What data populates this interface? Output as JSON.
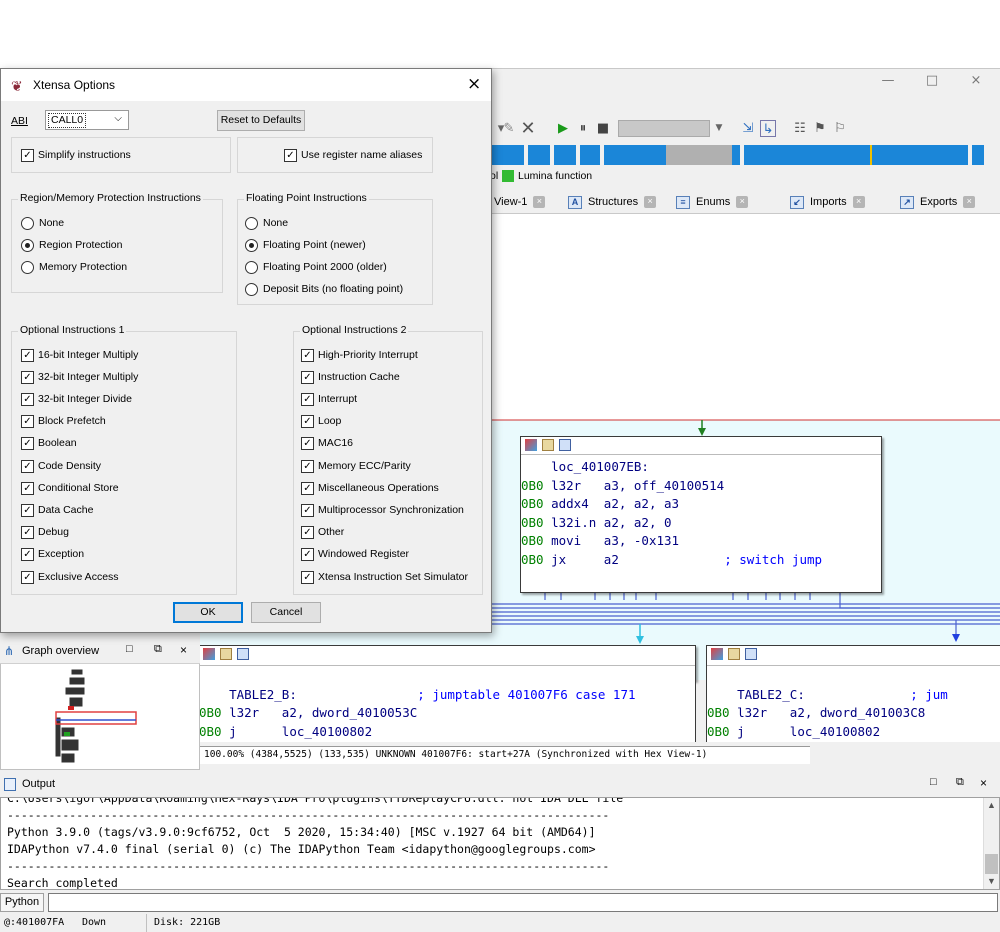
{
  "main_window": {
    "controls": {
      "minimize": "—",
      "maximize": "□",
      "close": "×"
    },
    "legend": {
      "partial_label": "ol",
      "lumina_label": "Lumina function",
      "lumina_color": "#33bb33"
    },
    "tabs": [
      {
        "label": "View-1",
        "icon": "hex-view-icon"
      },
      {
        "label": "Structures",
        "icon": "structures-icon"
      },
      {
        "label": "Enums",
        "icon": "enums-icon"
      },
      {
        "label": "Imports",
        "icon": "imports-icon"
      },
      {
        "label": "Exports",
        "icon": "exports-icon"
      }
    ],
    "graph": {
      "main_node": {
        "label": "loc_401007EB:",
        "lines": [
          {
            "addr": "0B0",
            "mnem": "l32r   ",
            "ops": "a3, off_40100514",
            "cmt": ""
          },
          {
            "addr": "0B0",
            "mnem": "addx4  ",
            "ops": "a2, a2, a3",
            "cmt": ""
          },
          {
            "addr": "0B0",
            "mnem": "l32i.n ",
            "ops": "a2, a2, 0",
            "cmt": ""
          },
          {
            "addr": "0B0",
            "mnem": "movi   ",
            "ops": "a3, -0x131",
            "cmt": ""
          },
          {
            "addr": "0B0",
            "mnem": "jx     ",
            "ops": "a2",
            "cmt": "; switch jump"
          }
        ]
      },
      "node_b": {
        "label": "TABLE2_B:",
        "label_cmt": "; jumptable 401007F6 case 171",
        "lines": [
          {
            "addr": "0B0",
            "mnem": "l32r   ",
            "ops": "a2, dword_4010053C"
          },
          {
            "addr": "0B0",
            "mnem": "j      ",
            "ops": "loc_40100802"
          }
        ]
      },
      "node_c": {
        "label": "TABLE2_C:",
        "label_cmt": "; jum",
        "lines": [
          {
            "addr": "0B0",
            "mnem": "l32r   ",
            "ops": "a2, dword_401003C8"
          },
          {
            "addr": "0B0",
            "mnem": "j      ",
            "ops": "loc_40100802"
          }
        ]
      }
    },
    "graph_status": "100.00% (4384,5525) (133,535) UNKNOWN 401007F6: start+27A (Synchronized with Hex View-1)",
    "overview": {
      "title": "Graph overview"
    },
    "output": {
      "title": "Output",
      "lines": [
        "C:\\Users\\igor\\AppData\\Roaming\\Hex-Rays\\IDA Pro\\plugins\\TTDReplayCPU.dll: not IDA DLL file",
        "---------------------------------------------------------------------------------------",
        "Python 3.9.0 (tags/v3.9.0:9cf6752, Oct  5 2020, 15:34:40) [MSC v.1927 64 bit (AMD64)]",
        "IDAPython v7.4.0 final (serial 0) (c) The IDAPython Team <idapython@googlegroups.com>",
        "---------------------------------------------------------------------------------------",
        "Search completed"
      ],
      "python_button": "Python"
    },
    "status_bar": {
      "address": "@:401007FA",
      "direction": "Down",
      "disk": "Disk: 221GB"
    }
  },
  "dialog": {
    "title": "Xtensa Options",
    "abi_label": "ABI",
    "abi_value": "CALL0",
    "reset_button": "Reset to Defaults",
    "simplify": "Simplify instructions",
    "register_aliases": "Use register name aliases",
    "region_group": {
      "title": "Region/Memory Protection Instructions",
      "options": [
        "None",
        "Region Protection",
        "Memory Protection"
      ],
      "selected": 1
    },
    "fp_group": {
      "title": "Floating Point Instructions",
      "options": [
        "None",
        "Floating Point (newer)",
        "Floating Point 2000 (older)",
        "Deposit Bits (no floating point)"
      ],
      "selected": 1
    },
    "optional1": {
      "title": "Optional Instructions 1",
      "items": [
        "16-bit Integer Multiply",
        "32-bit Integer Multiply",
        "32-bit Integer Divide",
        "Block Prefetch",
        "Boolean",
        "Code Density",
        "Conditional Store",
        "Data Cache",
        "Debug",
        "Exception",
        "Exclusive Access"
      ]
    },
    "optional2": {
      "title": "Optional Instructions 2",
      "items": [
        "High-Priority Interrupt",
        "Instruction Cache",
        "Interrupt",
        "Loop",
        "MAC16",
        "Memory ECC/Parity",
        "Miscellaneous Operations",
        "Multiprocessor Synchronization",
        "Other",
        "Windowed Register",
        "Xtensa Instruction Set Simulator"
      ]
    },
    "ok_button": "OK",
    "cancel_button": "Cancel"
  }
}
